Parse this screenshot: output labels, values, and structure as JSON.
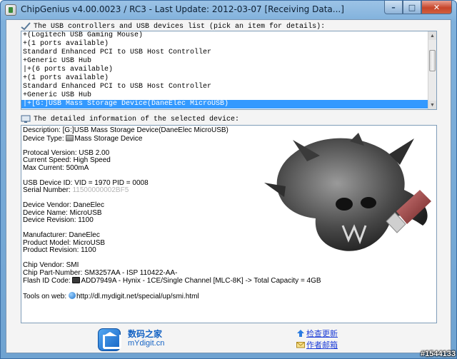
{
  "window": {
    "title": "ChipGenius v4.00.0023 / RC3 - Last Update: 2012-03-07 [Receiving Data...]",
    "minimize_glyph": "–",
    "maximize_glyph": "□",
    "close_glyph": "✕"
  },
  "device_list": {
    "header": "The USB controllers and USB devices list (pick an item for details):",
    "items": [
      "+(Logitech USB Gaming Mouse)",
      "+(1 ports available)",
      "Standard Enhanced PCI to USB Host Controller",
      "+Generic USB Hub",
      "|+(6 ports available)",
      "+(1 ports available)",
      "Standard Enhanced PCI to USB Host Controller",
      "+Generic USB Hub",
      "|+[G:]USB Mass Storage Device(DaneElec MicroUSB)"
    ],
    "selected_index": 8
  },
  "details": {
    "header": "The detailed information of the selected device:",
    "description": "Description: [G:]USB Mass Storage Device(DaneElec MicroUSB)",
    "device_type_label": "Device Type:",
    "device_type_value": "Mass Storage Device",
    "protocol_version": "Protocal Version: USB 2.00",
    "current_speed": "Current Speed: High Speed",
    "max_current": "Max Current: 500mA",
    "usb_device_id": "USB Device ID: VID = 1970 PID = 0008",
    "serial_label": "Serial Number:",
    "serial_value": "11500000002BF5",
    "device_vendor": "Device Vendor: DaneElec",
    "device_name": "Device Name: MicroUSB",
    "device_revision": "Device Revision: 1100",
    "manufacturer": "Manufacturer: DaneElec",
    "product_model": "Product Model: MicroUSB",
    "product_revision": "Product Revision: 1100",
    "chip_vendor": "Chip Vendor: SMI",
    "chip_part_number": "Chip Part-Number: SM3257AA - ISP 110422-AA-",
    "flash_id_label": "Flash ID Code:",
    "flash_id_value": "ADD7949A - Hynix - 1CE/Single Channel [MLC-8K] -> Total Capacity = 4GB",
    "tools_label": "Tools on web:",
    "tools_url": "http://dl.mydigit.net/special/up/smi.html"
  },
  "footer": {
    "logo_cn": "数码之家",
    "logo_en": "mYdigit.cn",
    "check_update": "检查更新",
    "author_mail": "作者邮箱"
  },
  "watermark": "#1544133",
  "colors": {
    "selection": "#3399ff",
    "link": "#1f3fd8",
    "brand": "#1463c4"
  }
}
